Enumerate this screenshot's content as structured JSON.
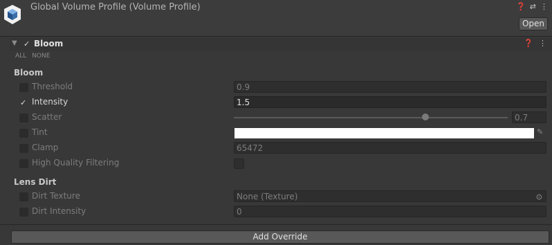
{
  "header": {
    "title": "Global Volume Profile (Volume Profile)",
    "open_label": "Open",
    "icons": [
      "help-icon",
      "preset-icon",
      "more-icon"
    ]
  },
  "component": {
    "title": "Bloom",
    "enabled": true,
    "all_label": "ALL",
    "none_label": "NONE"
  },
  "sections": {
    "bloom_label": "Bloom",
    "lens_dirt_label": "Lens Dirt"
  },
  "fields": {
    "threshold": {
      "label": "Threshold",
      "value": "0.9",
      "override": false
    },
    "intensity": {
      "label": "Intensity",
      "value": "1.5",
      "override": true
    },
    "scatter": {
      "label": "Scatter",
      "value": "0.7",
      "override": false,
      "slider_fraction": 0.7
    },
    "tint": {
      "label": "Tint",
      "color": "#ffffff",
      "override": false
    },
    "clamp": {
      "label": "Clamp",
      "value": "65472",
      "override": false
    },
    "high_quality": {
      "label": "High Quality Filtering",
      "checked": false,
      "override": false
    },
    "dirt_texture": {
      "label": "Dirt Texture",
      "value": "None (Texture)",
      "override": false
    },
    "dirt_intensity": {
      "label": "Dirt Intensity",
      "value": "0",
      "override": false
    }
  },
  "footer": {
    "add_override_label": "Add Override"
  }
}
